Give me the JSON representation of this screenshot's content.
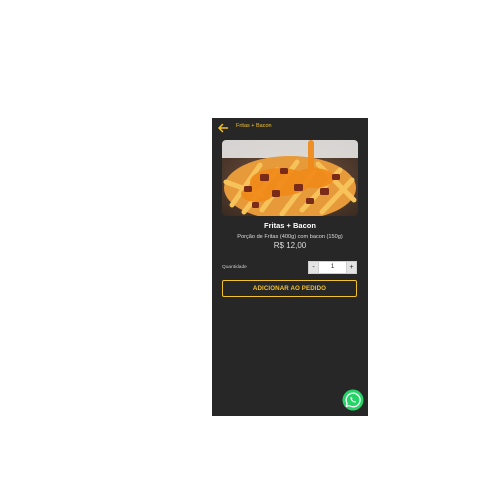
{
  "header": {
    "title": "Fritas + Bacon",
    "back_icon": "arrow-left-icon"
  },
  "product": {
    "name": "Fritas + Bacon",
    "description": "Porção de Fritas (400g) com bacon (150g)",
    "price": "R$ 12,00",
    "image": "fries-with-bacon-photo"
  },
  "quantity": {
    "label": "Quantidade",
    "minus": "-",
    "value": "1",
    "plus": "+"
  },
  "actions": {
    "add_to_order": "ADICIONAR AO PEDIDO"
  },
  "floating": {
    "whatsapp_icon": "whatsapp-icon"
  },
  "colors": {
    "background": "#272727",
    "accent": "#f2c12e",
    "whatsapp": "#25d366"
  }
}
